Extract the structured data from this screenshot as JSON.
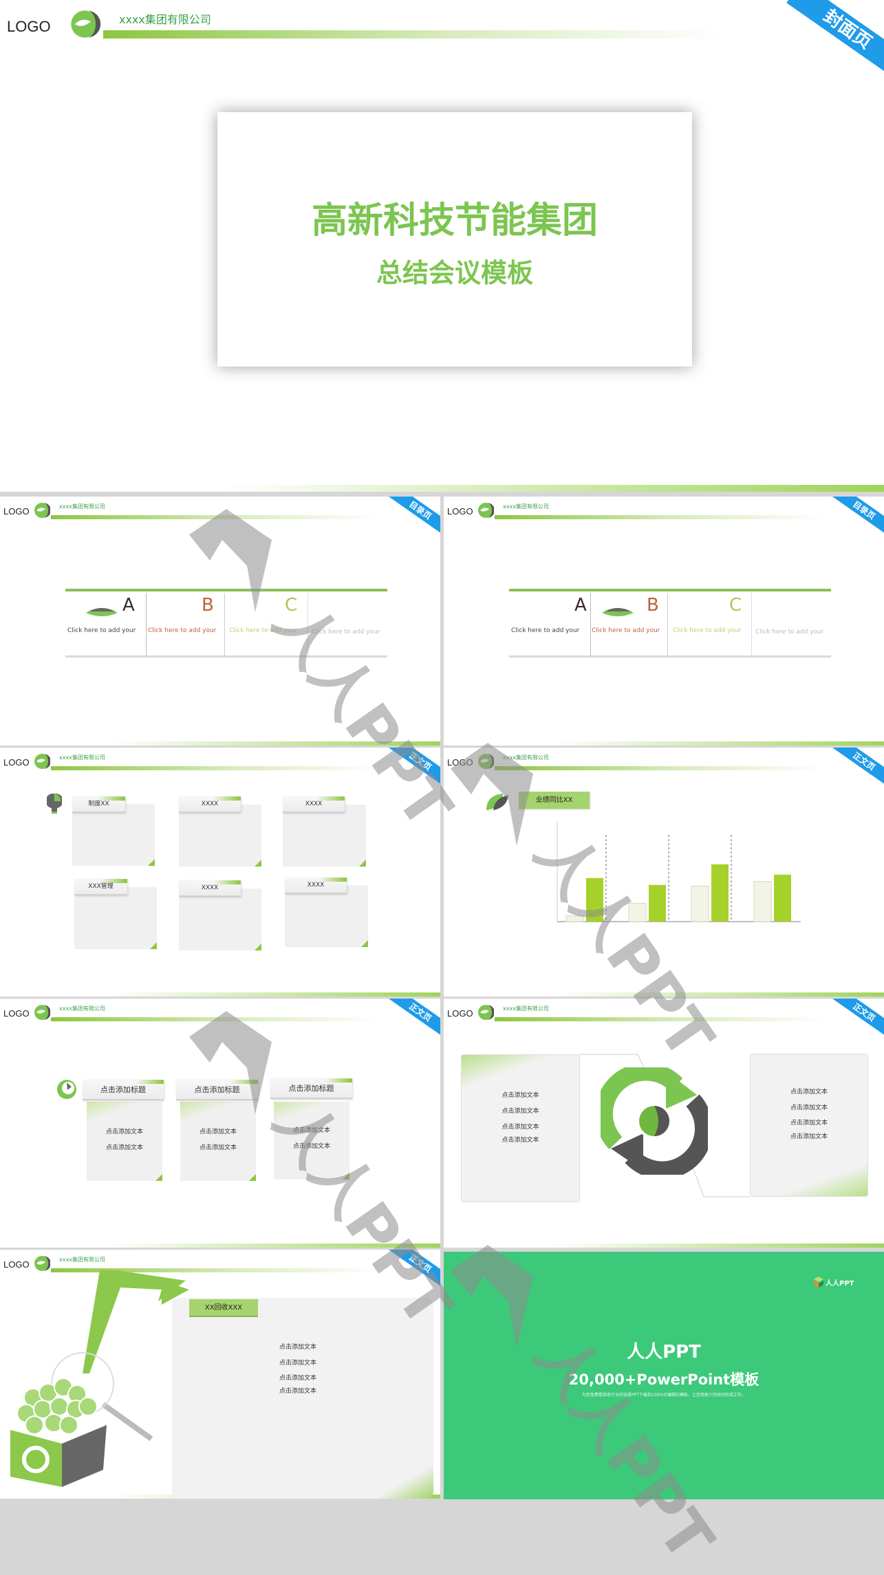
{
  "header": {
    "logo": "LOGO",
    "company": "xxxx集团有限公司"
  },
  "badges": {
    "cover": "封面页",
    "toc": "目录页",
    "body": "正文页"
  },
  "cover": {
    "title": "高新科技节能集团",
    "subtitle": "总结会议模板"
  },
  "toc": {
    "letters": [
      "A",
      "B",
      "C"
    ],
    "items": [
      "Click here to add your",
      "Click here to add your",
      "Click here to add your",
      "Click here to add your"
    ],
    "letter_colors": [
      "#3a2a2a",
      "#c0603a",
      "#a8cc55"
    ]
  },
  "grid": {
    "labels": [
      "制度XX",
      "XXXX",
      "XXXX",
      "XXX管理",
      "XXXX",
      "XXXX"
    ]
  },
  "chart": {
    "title": "业绩同比XX",
    "chart_data": {
      "type": "bar",
      "categories": [
        "",
        "",
        "",
        ""
      ],
      "series": [
        {
          "values": [
            2.5,
            8,
            15.5,
            17.5
          ],
          "color": "#f3f3e6"
        },
        {
          "values": [
            19,
            16,
            25,
            20.5
          ],
          "color": "#a6d12a"
        }
      ],
      "grid": "dashed vertical separators"
    }
  },
  "columns": {
    "titles": [
      "点击添加标题",
      "点击添加标题",
      "点击添加标题"
    ],
    "text": [
      "点击添加文本",
      "点击添加文本"
    ]
  },
  "cycle": {
    "left": [
      "点击添加文本",
      "点击添加文本",
      "点击添加文本",
      "点击添加文本"
    ],
    "right": [
      "点击添加文本",
      "点击添加文本",
      "点击添加文本",
      "点击添加文本"
    ]
  },
  "recycle": {
    "tab": "XX回收XXX",
    "lines": [
      "点击添加文本",
      "点击添加文本",
      "点击添加文本",
      "点击添加文本"
    ]
  },
  "promo": {
    "logo": "人人PPT",
    "title": "人人PPT",
    "subtitle": "20,000+PowerPoint模板",
    "desc": "为您免费提供各行业的优质PPT下载和100%可编辑的模板，让您用更少的时间完成工作。",
    "background": "#3cc97a"
  },
  "watermark": "人人PPT",
  "colors": {
    "accent": "#8dc63f",
    "badge": "#1e9be9",
    "title": "#7cc550"
  }
}
